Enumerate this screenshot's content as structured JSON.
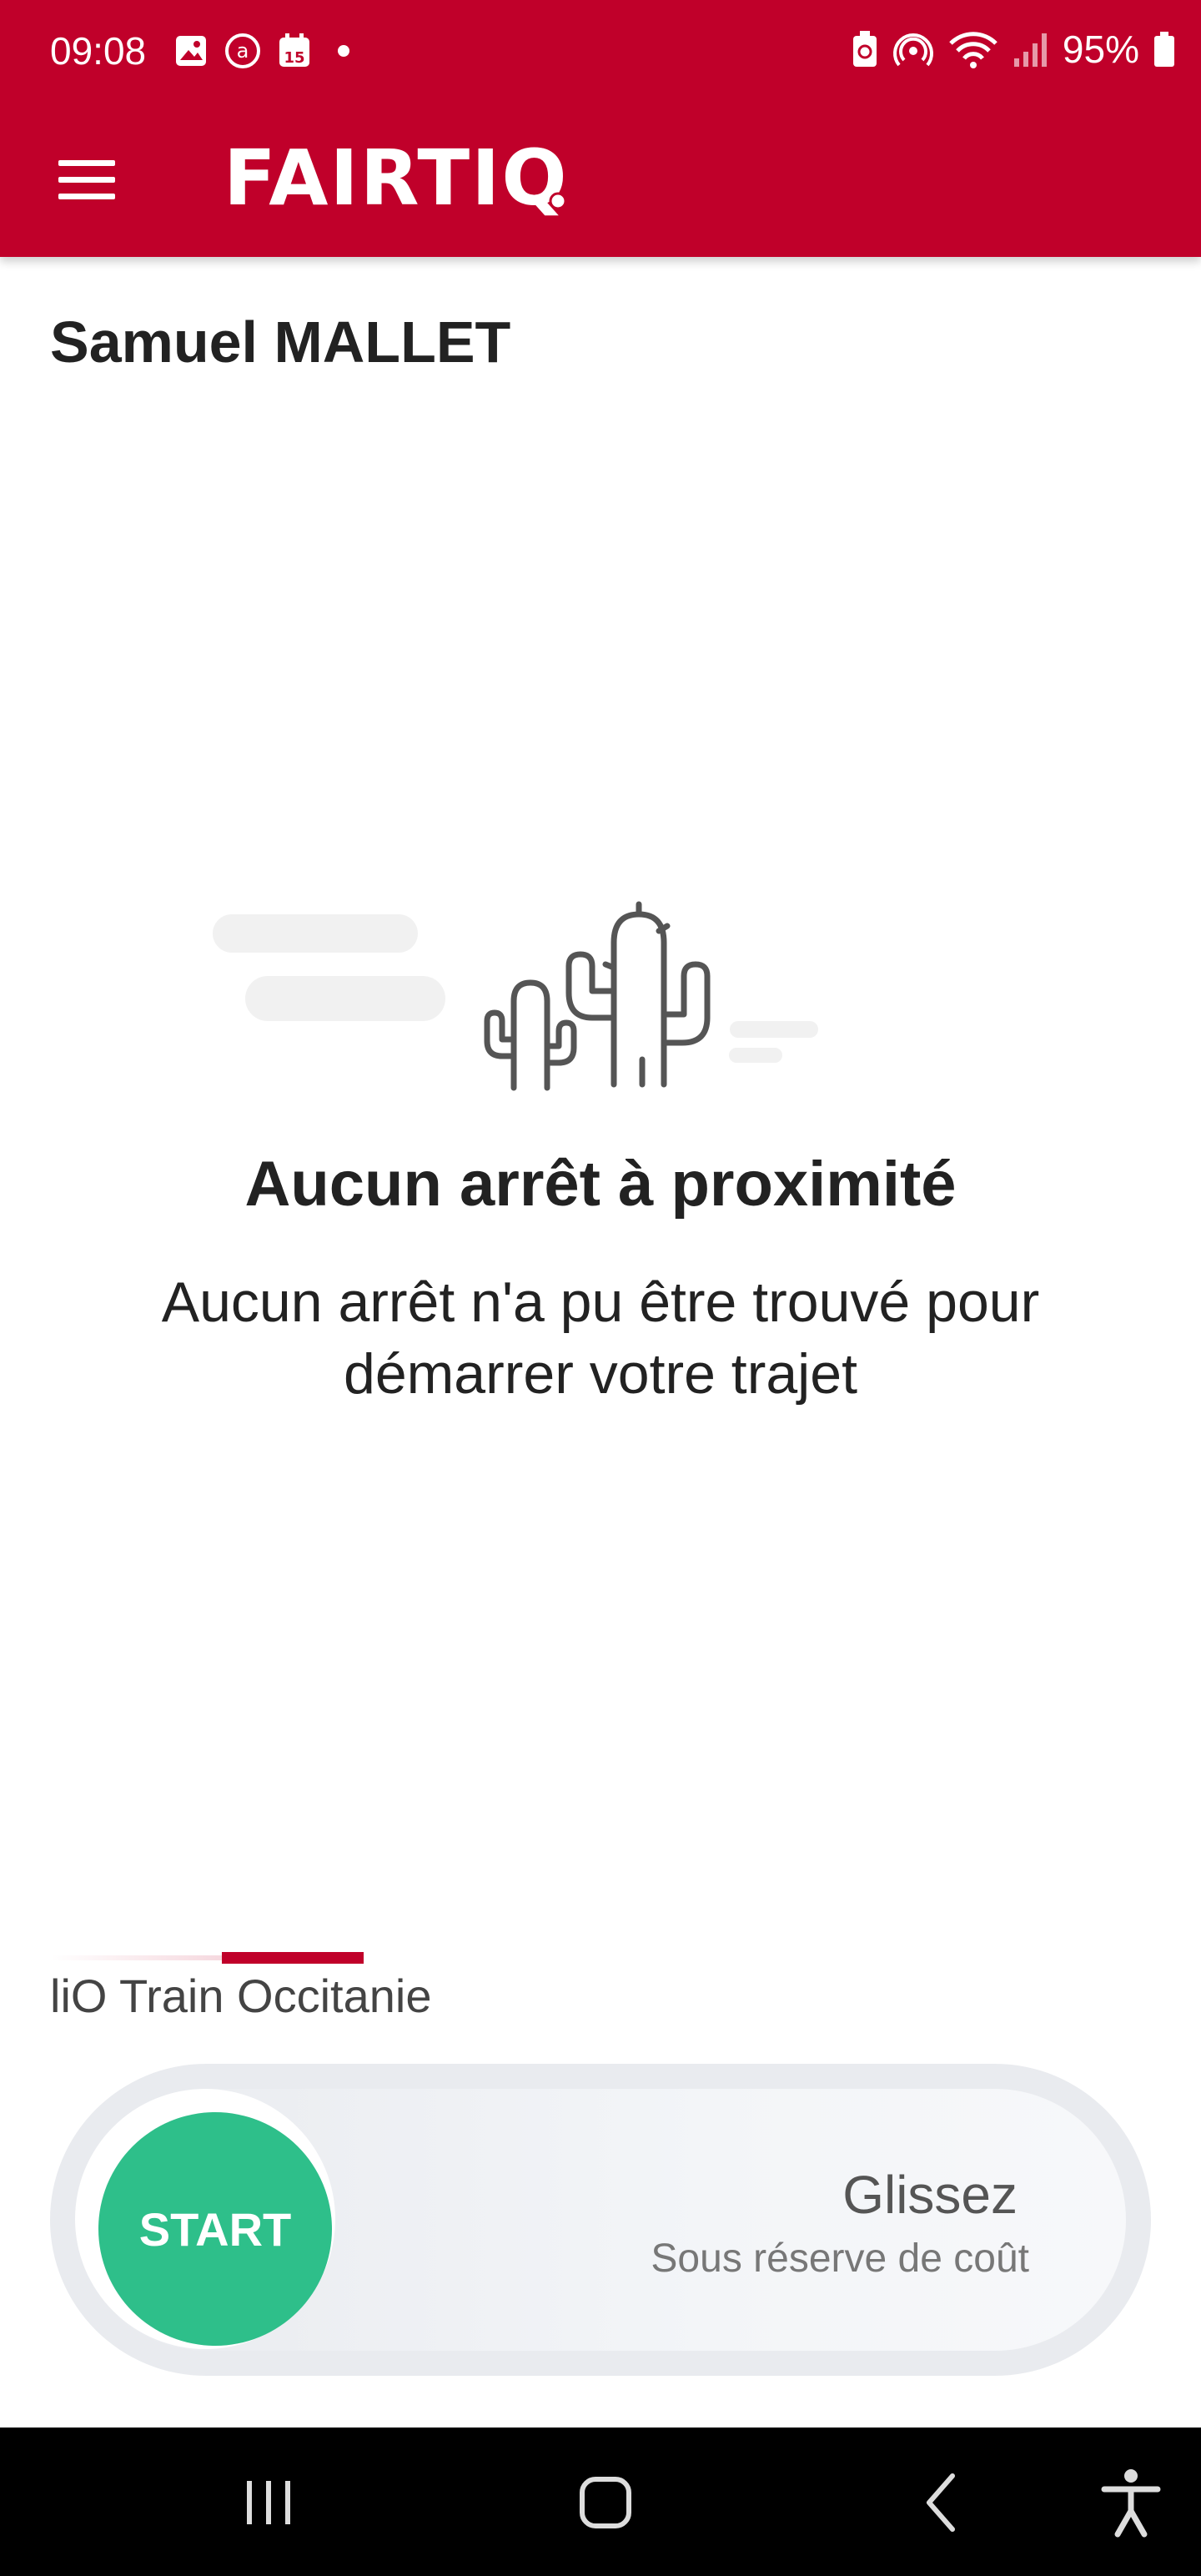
{
  "status_bar": {
    "time": "09:08",
    "battery": "95%",
    "left_icons": [
      "gallery-icon",
      "at-sign-icon",
      "calendar-icon",
      "dot-icon"
    ],
    "right_icons": [
      "battery-saver-icon",
      "hotspot-icon",
      "wifi-icon",
      "signal-icon",
      "battery-icon"
    ],
    "calendar_day": "15"
  },
  "app_bar": {
    "logo_text": "FAIRTIQ",
    "menu_icon": "hamburger-menu-icon",
    "color": "#c0002a"
  },
  "user": {
    "name": "Samuel MALLET"
  },
  "empty_state": {
    "illustration": "cactus-icon",
    "title": "Aucun arrêt à proximité",
    "description": "Aucun arrêt n'a pu être trouvé pour démarrer votre trajet"
  },
  "operator": {
    "label": "liO Train Occitanie"
  },
  "slider": {
    "button_label": "START",
    "hint": "Glissez",
    "subtext": "Sous réserve de coût",
    "button_color": "#2ebf8a"
  },
  "nav_bar": {
    "icons": [
      "recent-apps-icon",
      "home-icon",
      "back-icon",
      "accessibility-icon"
    ]
  }
}
